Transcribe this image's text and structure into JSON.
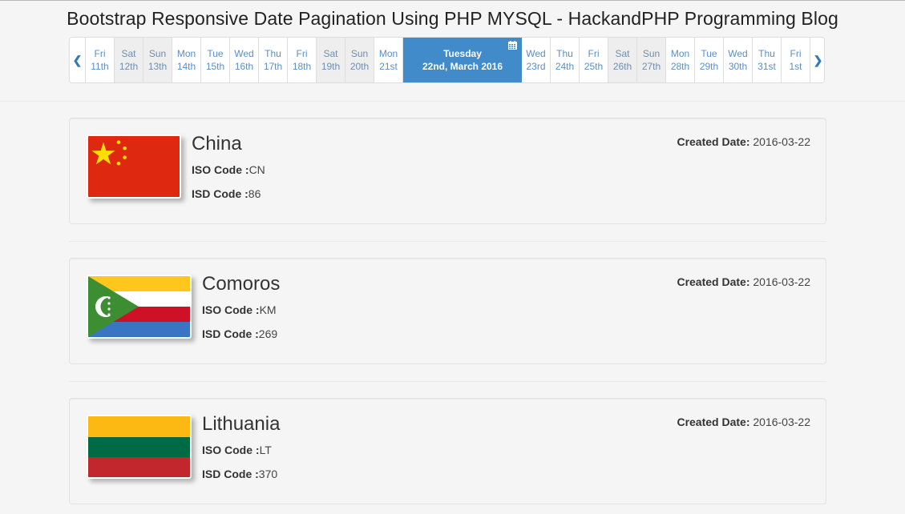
{
  "page": {
    "title": "Bootstrap Responsive Date Pagination Using PHP MYSQL - HackandPHP Programming Blog"
  },
  "pagination": {
    "prev_icon": "chevron-left-icon",
    "next_icon": "chevron-right-icon",
    "days_before": [
      {
        "dow": "Fri",
        "day": "11th",
        "weekend": false
      },
      {
        "dow": "Sat",
        "day": "12th",
        "weekend": true
      },
      {
        "dow": "Sun",
        "day": "13th",
        "weekend": true
      },
      {
        "dow": "Mon",
        "day": "14th",
        "weekend": false
      },
      {
        "dow": "Tue",
        "day": "15th",
        "weekend": false
      },
      {
        "dow": "Wed",
        "day": "16th",
        "weekend": false
      },
      {
        "dow": "Thu",
        "day": "17th",
        "weekend": false
      },
      {
        "dow": "Fri",
        "day": "18th",
        "weekend": false
      },
      {
        "dow": "Sat",
        "day": "19th",
        "weekend": true
      },
      {
        "dow": "Sun",
        "day": "20th",
        "weekend": true
      },
      {
        "dow": "Mon",
        "day": "21st",
        "weekend": false
      }
    ],
    "active": {
      "dow": "Tuesday",
      "date": "22nd, March 2016",
      "icon": "calendar-icon"
    },
    "days_after": [
      {
        "dow": "Wed",
        "day": "23rd",
        "weekend": false
      },
      {
        "dow": "Thu",
        "day": "24th",
        "weekend": false
      },
      {
        "dow": "Fri",
        "day": "25th",
        "weekend": false
      },
      {
        "dow": "Sat",
        "day": "26th",
        "weekend": true
      },
      {
        "dow": "Sun",
        "day": "27th",
        "weekend": true
      },
      {
        "dow": "Mon",
        "day": "28th",
        "weekend": false
      },
      {
        "dow": "Tue",
        "day": "29th",
        "weekend": false
      },
      {
        "dow": "Wed",
        "day": "30th",
        "weekend": false
      },
      {
        "dow": "Thu",
        "day": "31st",
        "weekend": false
      },
      {
        "dow": "Fri",
        "day": "1st",
        "weekend": false
      }
    ],
    "colors": {
      "active": "#428bca",
      "link": "#337ab7",
      "weekend_bg": "#eeeeee"
    }
  },
  "labels": {
    "iso": "ISO Code :",
    "isd": "ISD Code :",
    "created": "Created Date:"
  },
  "countries": [
    {
      "name": "China",
      "iso": "CN",
      "isd": "86",
      "created": "2016-03-22",
      "flag": "china-flag"
    },
    {
      "name": "Comoros",
      "iso": "KM",
      "isd": "269",
      "created": "2016-03-22",
      "flag": "comoros-flag"
    },
    {
      "name": "Lithuania",
      "iso": "LT",
      "isd": "370",
      "created": "2016-03-22",
      "flag": "lithuania-flag"
    }
  ]
}
